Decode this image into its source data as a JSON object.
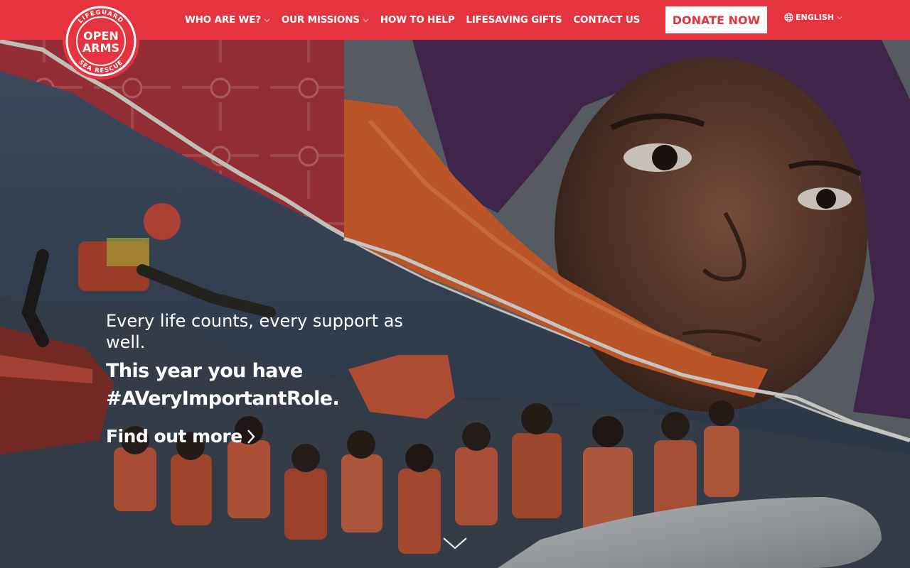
{
  "header": {
    "logo": {
      "line1": "OPEN",
      "line2": "ARMS",
      "ring_top": "LIFEGUARD",
      "ring_bottom": "SEA RESCUE"
    },
    "nav": [
      {
        "label": "WHO ARE WE?",
        "dropdown": true
      },
      {
        "label": "OUR MISSIONS",
        "dropdown": true
      },
      {
        "label": "HOW TO HELP",
        "dropdown": false
      },
      {
        "label": "LIFESAVING GIFTS",
        "dropdown": false
      },
      {
        "label": "CONTACT US",
        "dropdown": false
      }
    ],
    "donate_label": "DONATE NOW",
    "language": {
      "label": "ENGLISH",
      "icon": "globe-icon"
    }
  },
  "hero": {
    "tagline": "Every life counts, every support as well.",
    "headline_line1": "This year you have",
    "headline_line2": "#AVeryImportantRole.",
    "cta_label": "Find out more",
    "cta_icon": "chevron-right-icon",
    "scroll_icon": "chevron-down-icon"
  },
  "colors": {
    "brand_red": "#e5343f",
    "white": "#ffffff",
    "sea_blue": "#3e4d60",
    "lifejacket_orange": "#d9633e"
  }
}
